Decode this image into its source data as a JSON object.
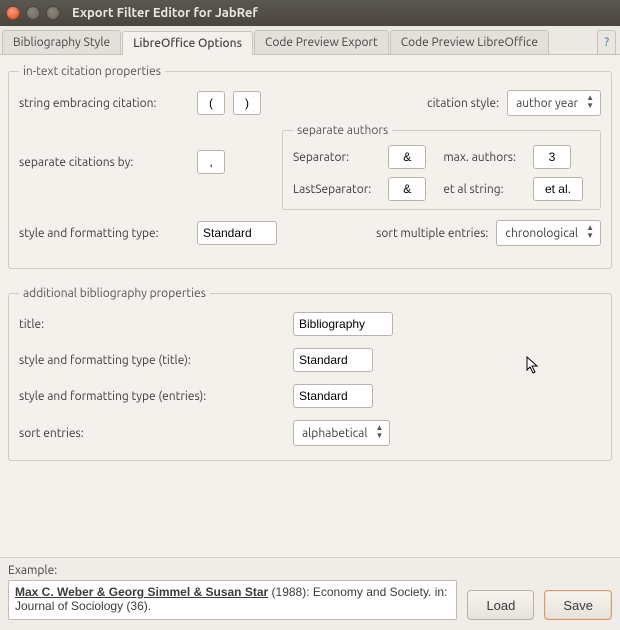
{
  "window": {
    "title": "Export Filter Editor for JabRef"
  },
  "tabs": {
    "items": [
      "Bibliography Style",
      "LibreOffice Options",
      "Code Preview Export",
      "Code Preview LibreOffice"
    ],
    "help": "?"
  },
  "intext": {
    "legend": "in-text citation properties",
    "embracing_label": "string embracing citation:",
    "embracing_open": "(",
    "embracing_close": ")",
    "citation_style_label": "citation style:",
    "citation_style_value": "author year",
    "separate_citations_label": "separate citations by:",
    "separate_citations_value": ",",
    "sep_authors_legend": "separate authors",
    "separator_label": "Separator:",
    "separator_value": "&",
    "max_authors_label": "max. authors:",
    "max_authors_value": "3",
    "last_separator_label": "LastSeparator:",
    "last_separator_value": "&",
    "etal_label": "et al string:",
    "etal_value": "et al.",
    "style_type_label": "style and formatting type:",
    "style_type_value": "Standard",
    "sort_multiple_label": "sort multiple entries:",
    "sort_multiple_value": "chronological"
  },
  "addl": {
    "legend": "additional bibliography properties",
    "title_label": "title:",
    "title_value": "Bibliography",
    "style_title_label": "style and formatting type (title):",
    "style_title_value": "Standard",
    "style_entries_label": "style and formatting type (entries):",
    "style_entries_value": "Standard",
    "sort_entries_label": "sort entries:",
    "sort_entries_value": "alphabetical"
  },
  "example": {
    "label": "Example:",
    "authors": "Max C. Weber & Georg Simmel & Susan Star",
    "rest": " (1988): Economy and Society. in: Journal of Sociology (36)."
  },
  "buttons": {
    "load": "Load",
    "save": "Save"
  }
}
